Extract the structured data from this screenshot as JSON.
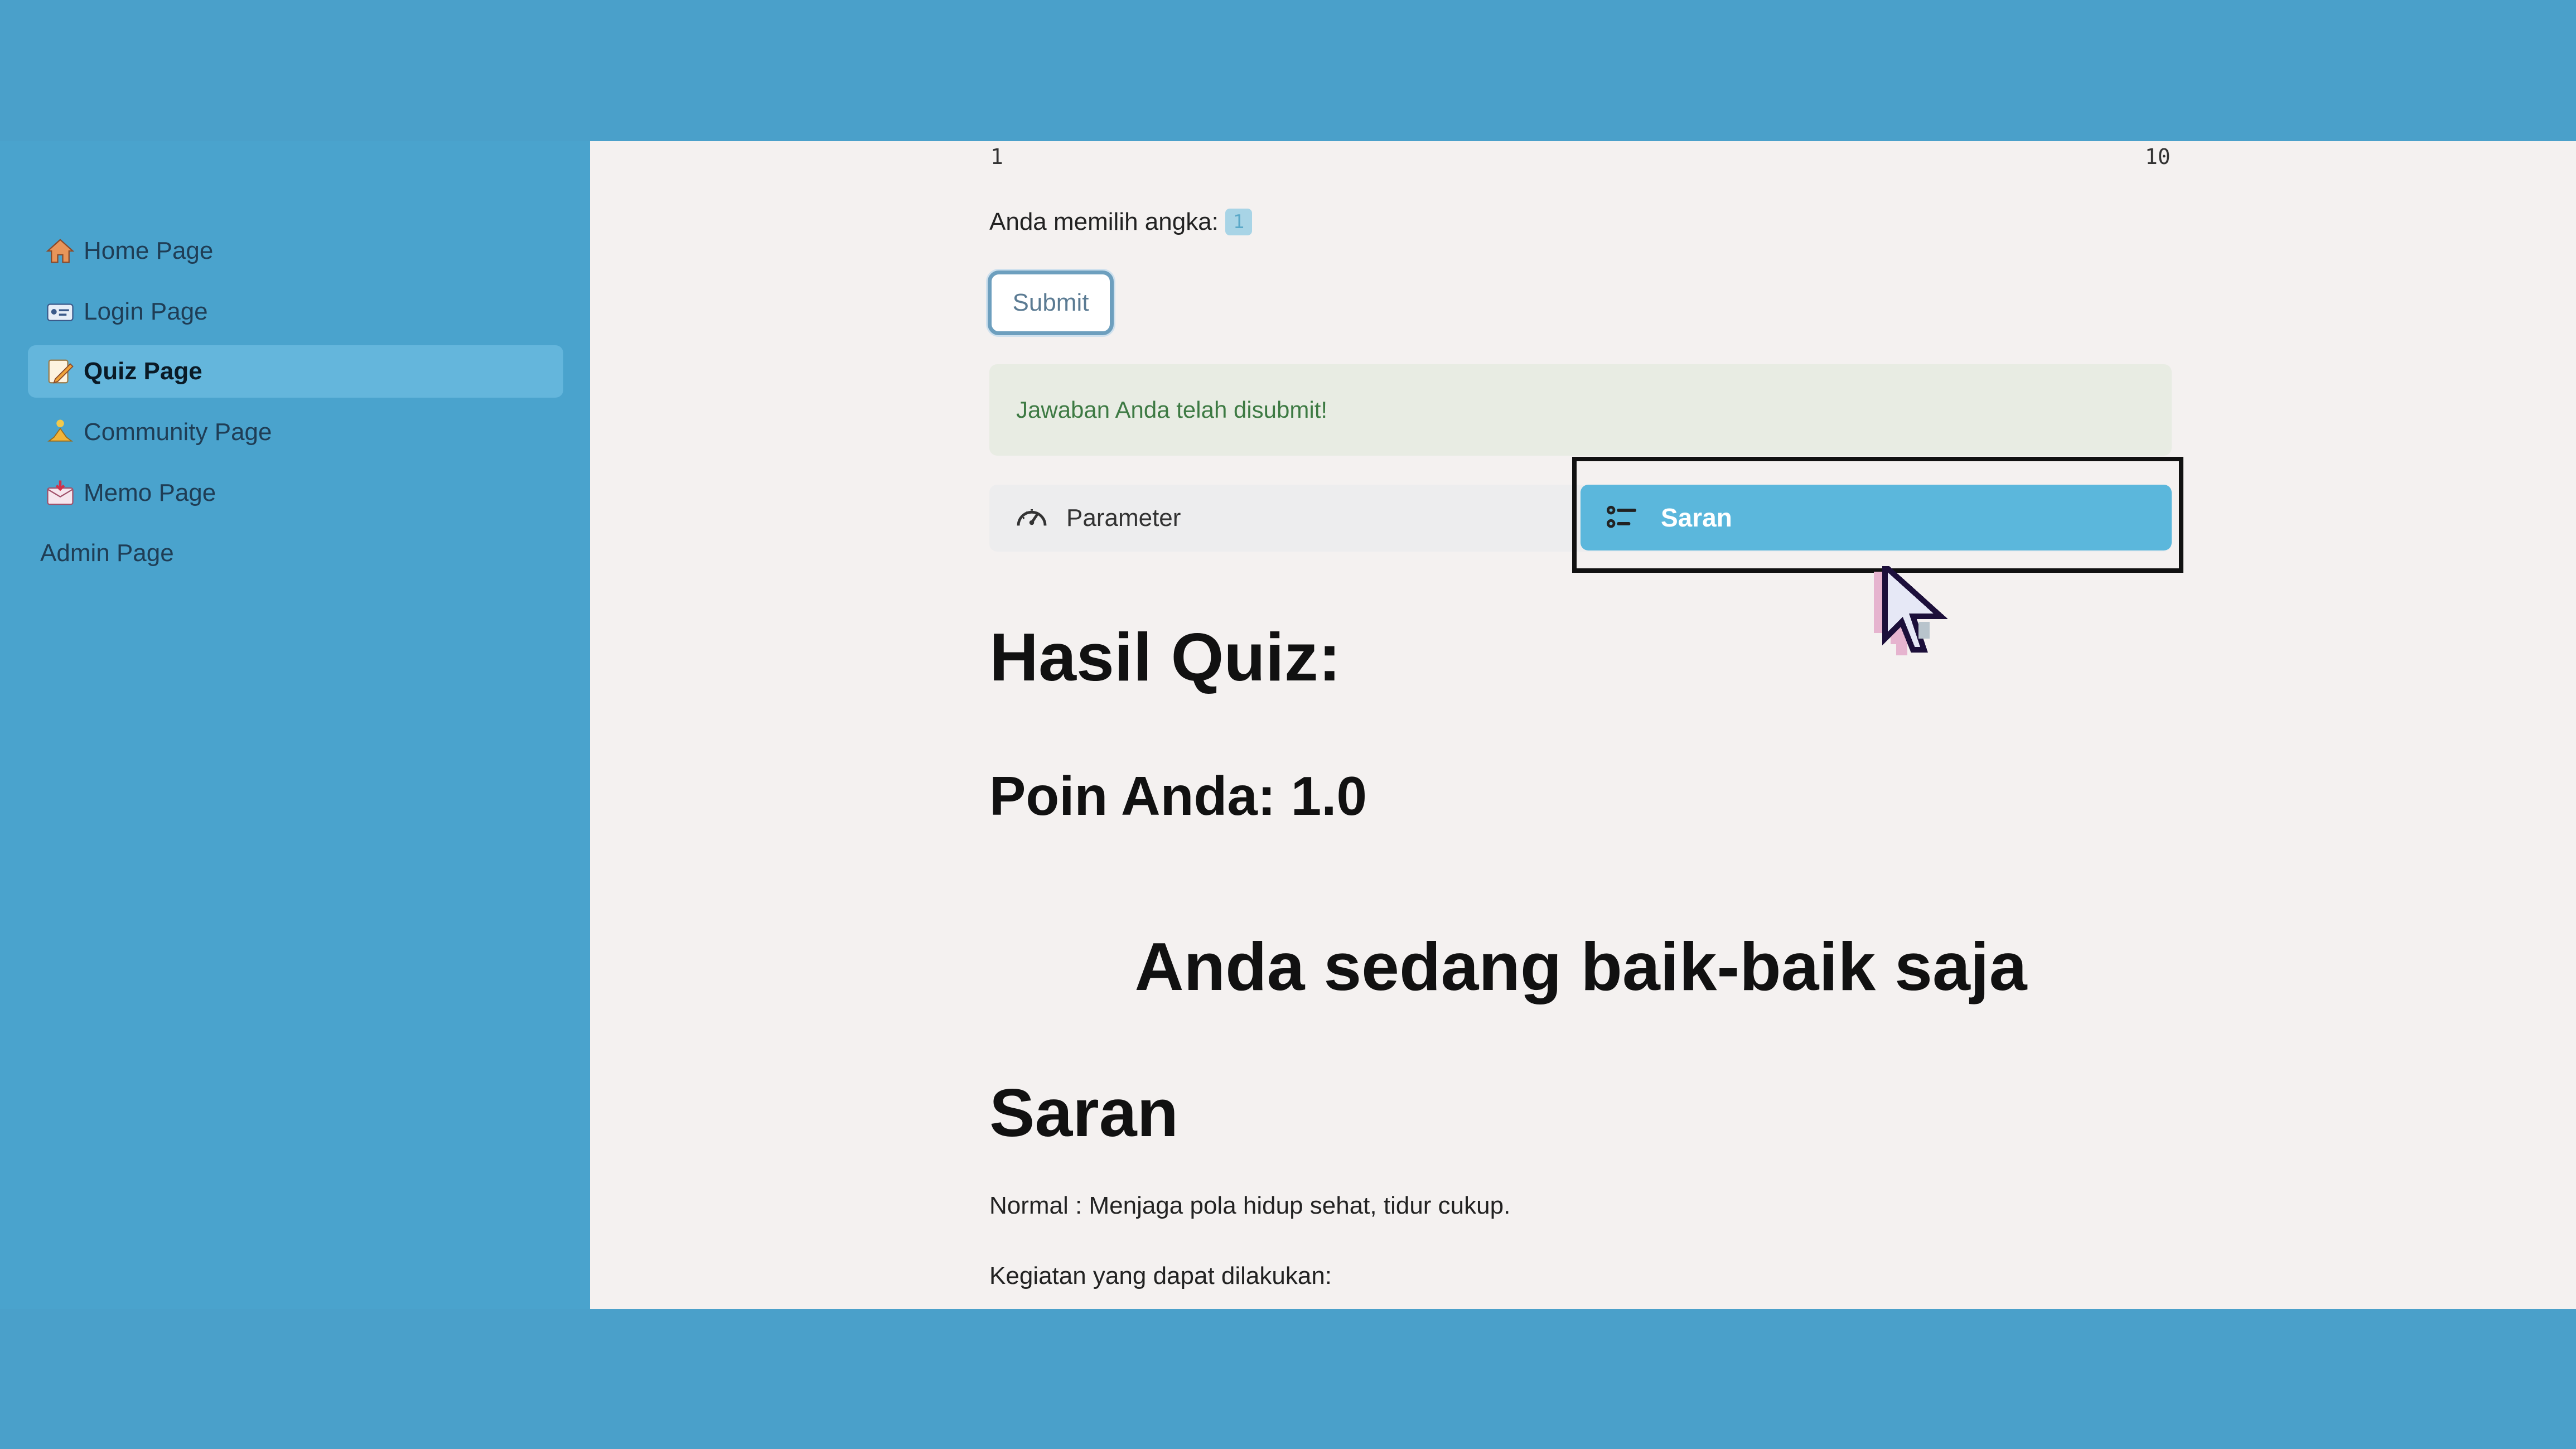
{
  "sidebar": {
    "items": [
      {
        "label": "Home Page",
        "icon": "house-icon"
      },
      {
        "label": "Login Page",
        "icon": "id-card-icon"
      },
      {
        "label": "Quiz Page",
        "icon": "memo-pencil-icon",
        "active": true
      },
      {
        "label": "Community Page",
        "icon": "person-meditating-icon"
      },
      {
        "label": "Memo Page",
        "icon": "envelope-arrow-icon"
      },
      {
        "label": "Admin Page"
      }
    ]
  },
  "slider": {
    "min_label": "1",
    "max_label": "10"
  },
  "choice": {
    "label": "Anda memilih angka:",
    "value": "1"
  },
  "submit": {
    "label": "Submit"
  },
  "alert": {
    "text": "Jawaban Anda telah disubmit!"
  },
  "tabs": [
    {
      "label": "Parameter",
      "icon": "gauge-icon",
      "active": false
    },
    {
      "label": "Saran",
      "icon": "list-icon",
      "active": true
    }
  ],
  "result": {
    "heading": "Hasil Quiz:",
    "points": "Poin Anda: 1.0",
    "status": "Anda sedang baik-baik saja",
    "saran_heading": "Saran",
    "normal_text": "Normal : Menjaga pola hidup sehat, tidur cukup.",
    "activities_label": "Kegiatan yang dapat dilakukan:"
  },
  "colors": {
    "background": "#4aa0ca",
    "sidebar": "#4aa3cd",
    "main": "#f4f1f0",
    "active_tab": "#5bb7dc",
    "alert_bg": "#e8ece3",
    "alert_text": "#3d7a43"
  }
}
